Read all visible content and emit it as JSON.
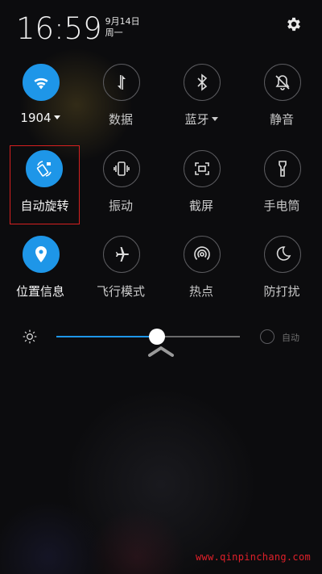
{
  "status": {
    "time": "16:59",
    "date": "9月14日",
    "weekday": "周一"
  },
  "quick_settings": {
    "row1": [
      {
        "label": "1904",
        "icon": "wifi-icon",
        "active": true,
        "has_dropdown": true
      },
      {
        "label": "数据",
        "icon": "mobile-data-icon",
        "active": false,
        "has_dropdown": false
      },
      {
        "label": "蓝牙",
        "icon": "bluetooth-icon",
        "active": false,
        "has_dropdown": true
      },
      {
        "label": "静音",
        "icon": "mute-bell-icon",
        "active": false,
        "has_dropdown": false
      }
    ],
    "row2": [
      {
        "label": "自动旋转",
        "icon": "auto-rotate-icon",
        "active": true
      },
      {
        "label": "振动",
        "icon": "vibrate-icon",
        "active": false
      },
      {
        "label": "截屏",
        "icon": "screenshot-icon",
        "active": false
      },
      {
        "label": "手电筒",
        "icon": "flashlight-icon",
        "active": false
      }
    ],
    "row3": [
      {
        "label": "位置信息",
        "icon": "location-icon",
        "active": true
      },
      {
        "label": "飞行模式",
        "icon": "airplane-icon",
        "active": false
      },
      {
        "label": "热点",
        "icon": "hotspot-icon",
        "active": false
      },
      {
        "label": "防打扰",
        "icon": "do-not-disturb-moon-icon",
        "active": false
      }
    ]
  },
  "brightness": {
    "level": 0.55,
    "auto_label": "自动"
  },
  "colors": {
    "accent": "#1e96e8",
    "highlight_box": "#d62020",
    "watermark": "#e0202a"
  },
  "watermark": "www.qinpinchang.com"
}
